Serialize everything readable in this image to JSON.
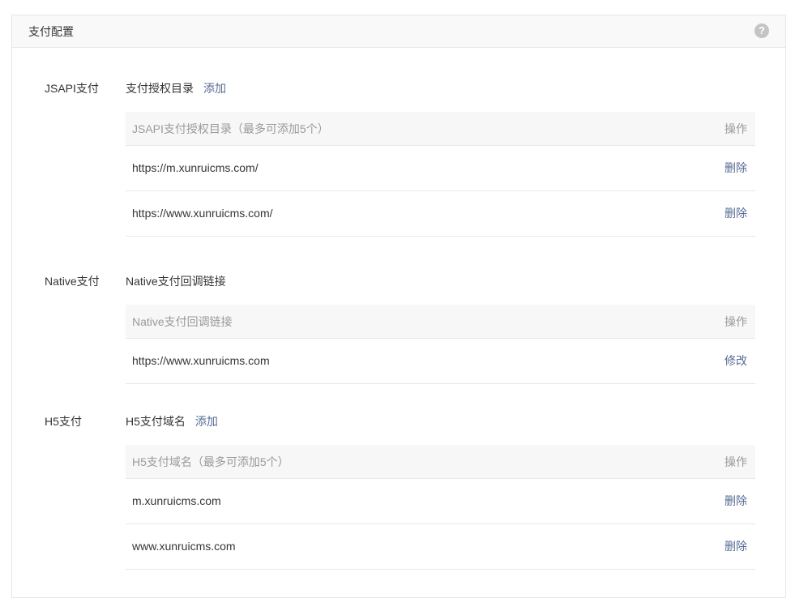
{
  "panel": {
    "title": "支付配置",
    "help_icon": "question-circle-icon",
    "help_glyph": "?"
  },
  "jsapi": {
    "label": "JSAPI支付",
    "subhead": "支付授权目录",
    "add_link": "添加",
    "table": {
      "header_main": "JSAPI支付授权目录（最多可添加5个）",
      "header_op": "操作",
      "rows": [
        {
          "value": "https://m.xunruicms.com/",
          "action": "删除"
        },
        {
          "value": "https://www.xunruicms.com/",
          "action": "删除"
        }
      ]
    }
  },
  "native": {
    "label": "Native支付",
    "subhead": "Native支付回调链接",
    "table": {
      "header_main": "Native支付回调链接",
      "header_op": "操作",
      "rows": [
        {
          "value": "https://www.xunruicms.com",
          "action": "修改"
        }
      ]
    }
  },
  "h5": {
    "label": "H5支付",
    "subhead": "H5支付域名",
    "add_link": "添加",
    "table": {
      "header_main": "H5支付域名（最多可添加5个）",
      "header_op": "操作",
      "rows": [
        {
          "value": "m.xunruicms.com",
          "action": "删除"
        },
        {
          "value": "www.xunruicms.com",
          "action": "删除"
        }
      ]
    }
  },
  "colors": {
    "link": "#576b95",
    "muted": "#9a9a9a",
    "border": "#e7e7eb",
    "header_bg": "#f7f7f7"
  }
}
